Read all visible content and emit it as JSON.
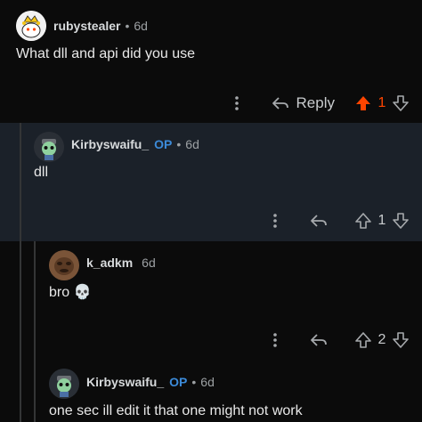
{
  "colors": {
    "upvote_active": "#ff4500",
    "op_badge": "#3c8bd9",
    "highlight_bg": "#1b2129"
  },
  "comments": [
    {
      "author": "rubystealer",
      "op": "",
      "separator": "•",
      "age": "6d",
      "body": "What dll and api did you use",
      "reply_label": "Reply",
      "score": "1",
      "upvoted": true,
      "avatar": "snoo-avatar-yellow"
    },
    {
      "author": "Kirbyswaifu_",
      "op": "OP",
      "separator": "•",
      "age": "6d",
      "body": "dll",
      "reply_label": "",
      "score": "1",
      "upvoted": false,
      "avatar": "snoo-avatar-robot"
    },
    {
      "author": "k_adkm",
      "op": "",
      "separator": "",
      "age": "6d",
      "body": "bro 💀",
      "reply_label": "",
      "score": "2",
      "upvoted": false,
      "avatar": "user-photo-avatar"
    },
    {
      "author": "Kirbyswaifu_",
      "op": "OP",
      "separator": "•",
      "age": "6d",
      "body": "one sec ill edit it that one might not work",
      "reply_label": "",
      "score": "",
      "upvoted": false,
      "avatar": "snoo-avatar-robot"
    }
  ]
}
